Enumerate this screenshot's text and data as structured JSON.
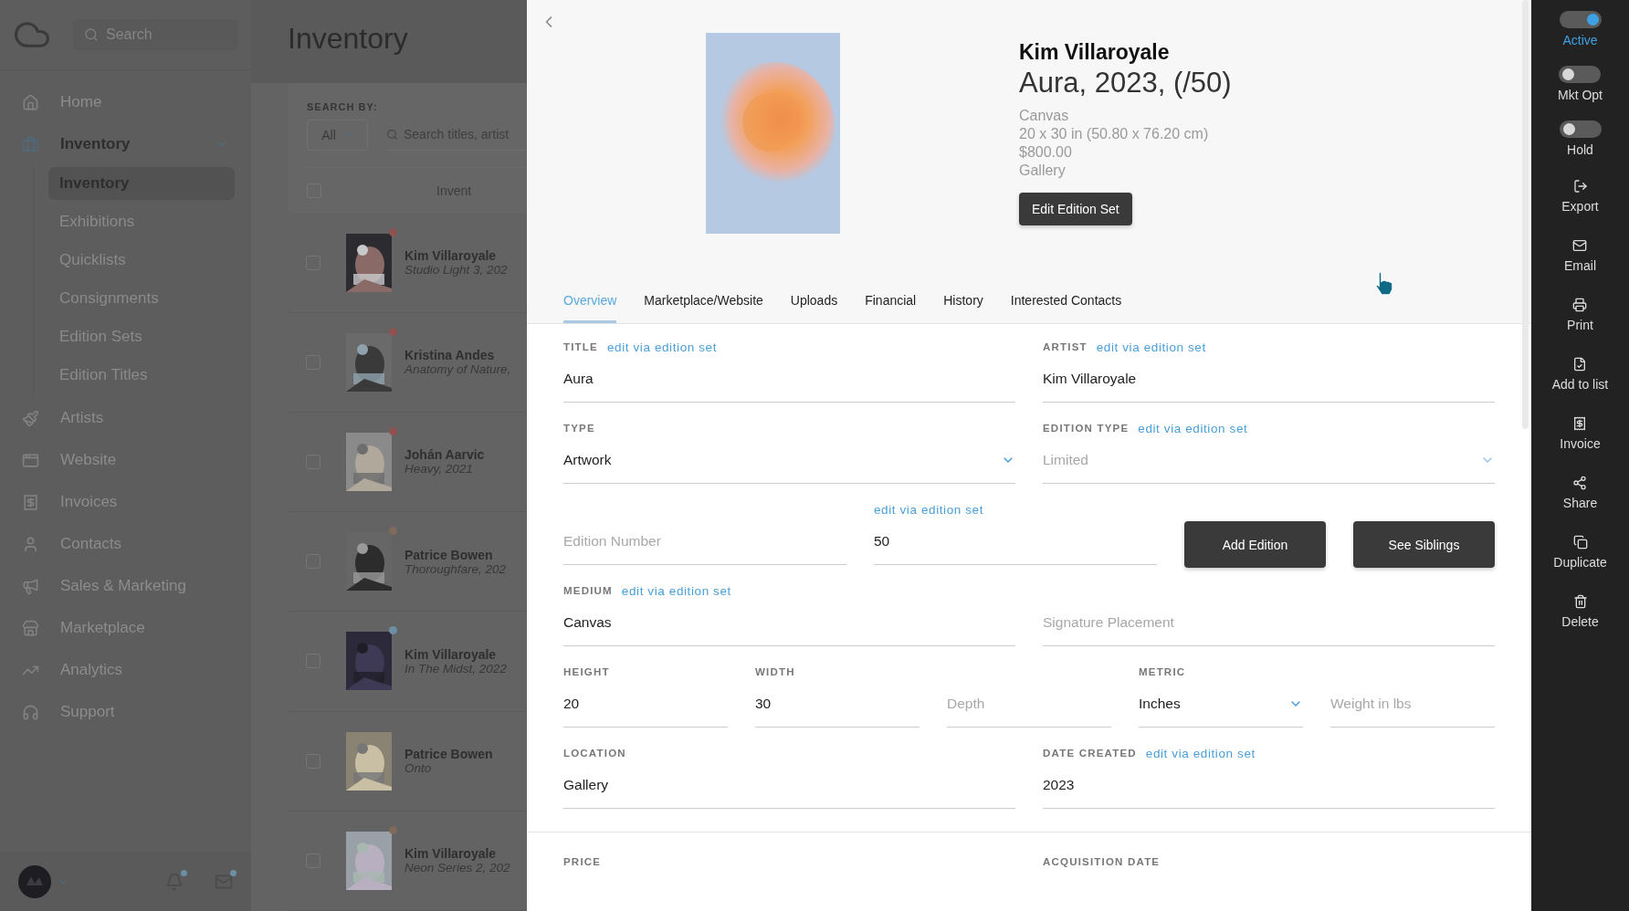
{
  "sidebar": {
    "search": {
      "placeholder": "Search"
    },
    "items": [
      {
        "label": "Home",
        "selected": false
      },
      {
        "label": "Inventory",
        "selected": true,
        "expanded": true,
        "children": [
          {
            "label": "Inventory",
            "selected": true
          },
          {
            "label": "Exhibitions",
            "selected": false
          },
          {
            "label": "Quicklists",
            "selected": false
          },
          {
            "label": "Consignments",
            "selected": false
          },
          {
            "label": "Edition Sets",
            "selected": false
          },
          {
            "label": "Edition Titles",
            "selected": false
          }
        ]
      },
      {
        "label": "Artists",
        "selected": false
      },
      {
        "label": "Website",
        "selected": false
      },
      {
        "label": "Invoices",
        "selected": false
      },
      {
        "label": "Contacts",
        "selected": false
      },
      {
        "label": "Sales & Marketing",
        "selected": false
      },
      {
        "label": "Marketplace",
        "selected": false
      },
      {
        "label": "Analytics",
        "selected": false
      },
      {
        "label": "Support",
        "selected": false
      }
    ],
    "footer": {
      "notifications_unread": true,
      "messages_unread": true
    }
  },
  "inventory": {
    "title": "Inventory",
    "search_by_label": "SEARCH BY:",
    "filter": "All",
    "search": {
      "placeholder": "Search titles, artist"
    },
    "column_header": "Invent",
    "select_all_checked": false,
    "rows": [
      {
        "artist": "Kim Villaroyale",
        "title": "Studio Light 3, 202",
        "color": "#8e5350",
        "checked": false
      },
      {
        "artist": "Kristina Andes",
        "title": "Anatomy of Nature,",
        "color": "#8e5350",
        "checked": false
      },
      {
        "artist": "Johán Aarvic",
        "title": "Heavy, 2021",
        "color": "#8e5350",
        "checked": false
      },
      {
        "artist": "Patrice Bowen",
        "title": "Thoroughfare, 202",
        "color": "#7f6a5c",
        "checked": false
      },
      {
        "artist": "Kim Villaroyale",
        "title": "In The Midst, 2022",
        "color": "#6b8fa3",
        "checked": false
      },
      {
        "artist": "Patrice Bowen",
        "title": "Onto",
        "checked": false
      },
      {
        "artist": "Kim Villaroyale",
        "title": "Neon Series 2, 202",
        "color": "#7f6a5c",
        "checked": false
      }
    ]
  },
  "detail": {
    "artist": "Kim Villaroyale",
    "title": "Aura, 2023, (/50)",
    "details": [
      "Canvas",
      "20 x 30 in (50.80 x 76.20 cm)",
      "$800.00",
      "Gallery"
    ],
    "edit_button": "Edit Edition Set",
    "tabs": [
      {
        "label": "Overview",
        "selected": true
      },
      {
        "label": "Marketplace/Website",
        "selected": false
      },
      {
        "label": "Uploads",
        "selected": false
      },
      {
        "label": "Financial",
        "selected": false
      },
      {
        "label": "History",
        "selected": false
      },
      {
        "label": "Interested Contacts",
        "selected": false
      }
    ],
    "rows": [
      {
        "cells": [
          {
            "kind": "text",
            "label": "TITLE",
            "link": "edit via edition set",
            "value": "Aura"
          },
          {
            "kind": "text",
            "label": "ARTIST",
            "link": "edit via edition set",
            "value": "Kim Villaroyale"
          }
        ]
      },
      {
        "cells": [
          {
            "kind": "select",
            "label": "TYPE",
            "value": "Artwork",
            "disabled": false
          },
          {
            "kind": "select",
            "label": "EDITION TYPE",
            "link": "edit via edition set",
            "value": "Limited",
            "disabled": true
          }
        ]
      },
      {
        "edition": {
          "number_placeholder": "Edition Number",
          "link": "edit via edition set",
          "value": "50",
          "buttons": [
            "Add Edition",
            "See Siblings"
          ]
        }
      },
      {
        "cells": [
          {
            "kind": "text",
            "label": "MEDIUM",
            "link": "edit via edition set",
            "value": "Canvas"
          },
          {
            "kind": "text",
            "placeholder": "Signature Placement"
          }
        ]
      },
      {
        "cells": [
          {
            "kind": "text",
            "label": "HEIGHT",
            "value": "20"
          },
          {
            "kind": "text",
            "label": "WIDTH",
            "value": "30"
          },
          {
            "kind": "text",
            "placeholder": "Depth"
          },
          {
            "kind": "select",
            "label": "METRIC",
            "value": "Inches",
            "disabled": false
          },
          {
            "kind": "text",
            "placeholder": "Weight in lbs"
          }
        ]
      },
      {
        "cells": [
          {
            "kind": "text",
            "label": "LOCATION",
            "value": "Gallery"
          },
          {
            "kind": "text",
            "label": "DATE CREATED",
            "link": "edit via edition set",
            "value": "2023"
          }
        ]
      }
    ],
    "footer_labels": [
      "PRICE",
      "ACQUISITION DATE"
    ]
  },
  "rail": {
    "toggles": [
      {
        "label": "Active",
        "on": true
      },
      {
        "label": "Mkt Opt",
        "on": false
      },
      {
        "label": "Hold",
        "on": false
      }
    ],
    "actions": [
      "Export",
      "Email",
      "Print",
      "Add to list",
      "Invoice",
      "Share",
      "Duplicate",
      "Delete"
    ]
  }
}
